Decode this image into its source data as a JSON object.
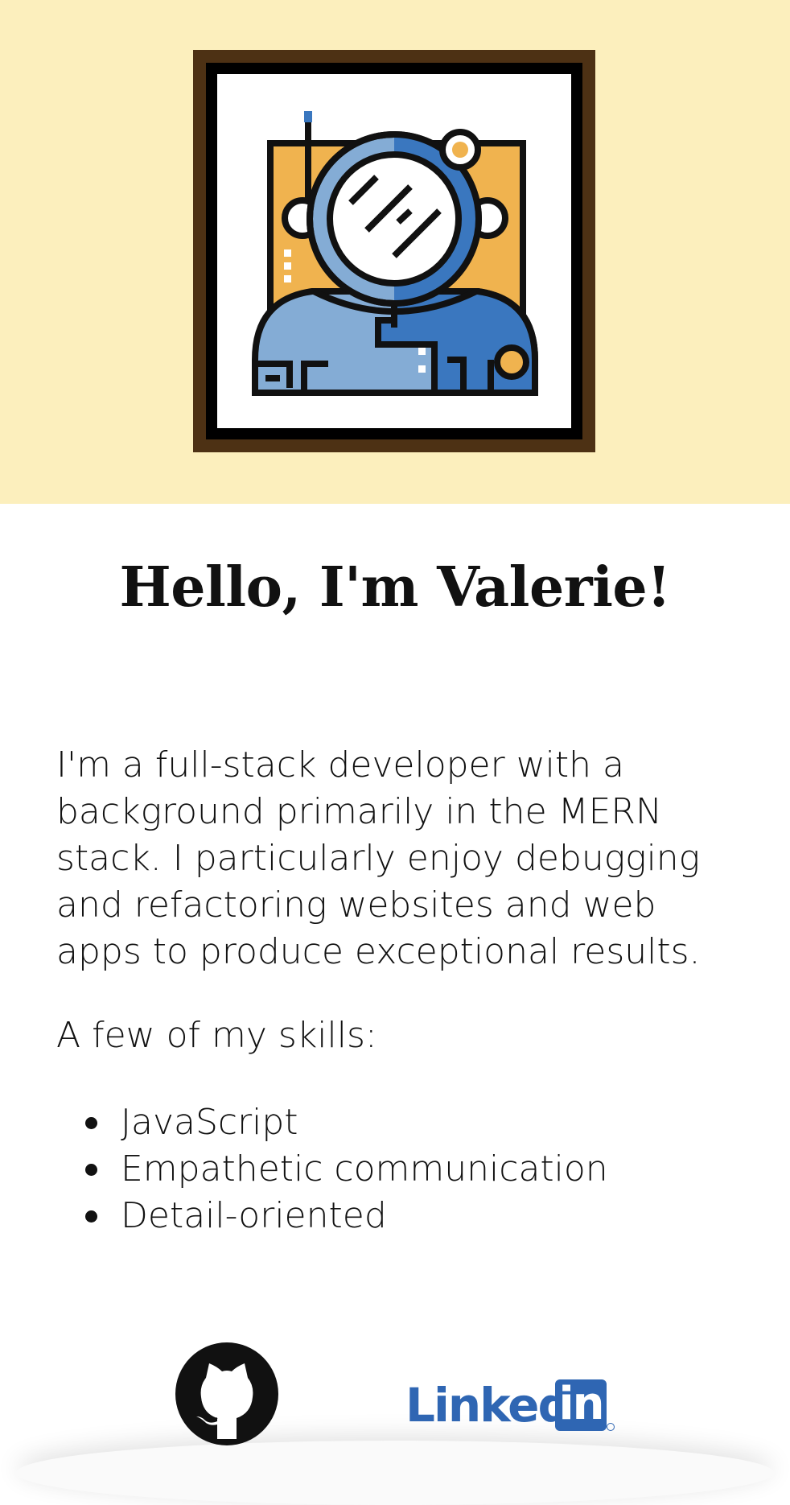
{
  "hero": {
    "avatar_icon": "astronaut-avatar-icon",
    "background_color": "#fcefbd",
    "frame_color": "#4d3114"
  },
  "heading": "Hello, I'm Valerie!",
  "bio": "I'm a full-stack developer with a background primarily in the MERN stack. I particularly enjoy debugging and refactoring websites and web apps to produce exceptional results.",
  "skills_intro": "A few of my skills:",
  "skills": [
    "JavaScript",
    "Empathetic communication",
    "Detail-oriented"
  ],
  "social": {
    "github_icon": "github-icon",
    "linkedin_word": "Linked",
    "linkedin_box": "in",
    "linkedin_color": "#2f66b3"
  }
}
